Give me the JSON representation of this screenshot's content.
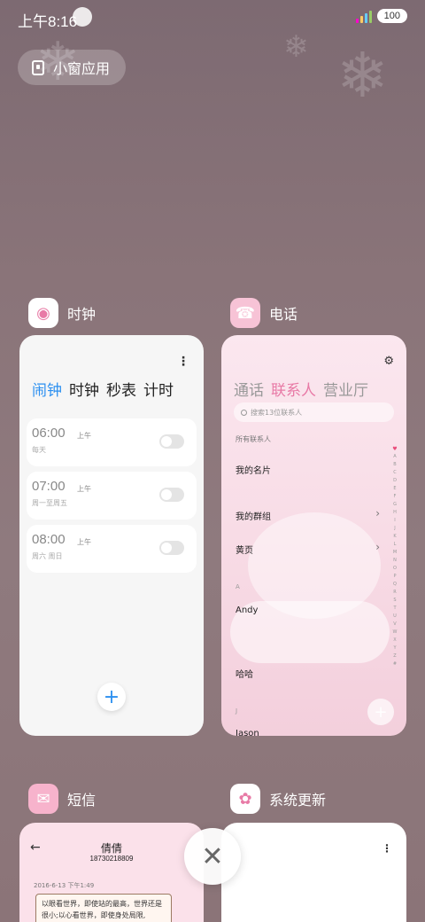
{
  "status_bar": {
    "time": "上午8:16",
    "battery": "100"
  },
  "floating_window": {
    "label": "小窗应用"
  },
  "apps": {
    "clock": {
      "name": "时钟",
      "tabs": [
        {
          "label": "闹钟",
          "active": true
        },
        {
          "label": "时钟"
        },
        {
          "label": "秒表"
        },
        {
          "label": "计时"
        }
      ],
      "alarms": [
        {
          "time": "06:00",
          "ampm": "上午",
          "repeat": "每天"
        },
        {
          "time": "07:00",
          "ampm": "上午",
          "repeat": "周一至周五"
        },
        {
          "time": "08:00",
          "ampm": "上午",
          "repeat": "周六 周日"
        }
      ],
      "add": "+",
      "more": "⋮"
    },
    "phone": {
      "name": "电话",
      "tabs": [
        {
          "label": "通话"
        },
        {
          "label": "联系人",
          "active": true
        },
        {
          "label": "营业厅"
        }
      ],
      "search_placeholder": "搜索13位联系人",
      "filter": "所有联系人",
      "rows": [
        {
          "name": "我的名片"
        },
        {
          "name": "我的群组"
        },
        {
          "name": "黄页"
        },
        {
          "letter": "A"
        },
        {
          "name": "Andy"
        },
        {
          "name": "哈哈"
        },
        {
          "letter": "J"
        },
        {
          "name": "Jason"
        }
      ],
      "alphabet": [
        "A",
        "B",
        "C",
        "D",
        "E",
        "F",
        "G",
        "H",
        "I",
        "J",
        "K",
        "L",
        "M",
        "N",
        "O",
        "P",
        "Q",
        "R",
        "S",
        "T",
        "U",
        "V",
        "W",
        "X",
        "Y",
        "Z",
        "#"
      ],
      "add": "+"
    },
    "sms": {
      "name": "短信",
      "contact": "倩倩",
      "number": "18730218809",
      "date": "2016-6-13 下午1:49",
      "message": "以眼看世界，即使站的最高，世界还是很小;以心看世界，即使身处局限,"
    },
    "update": {
      "name": "系统更新",
      "more": "⋮"
    }
  },
  "close_label": "✕",
  "colors": {
    "accent_blue": "#2b8ff0",
    "accent_pink": "#e87aa6"
  }
}
